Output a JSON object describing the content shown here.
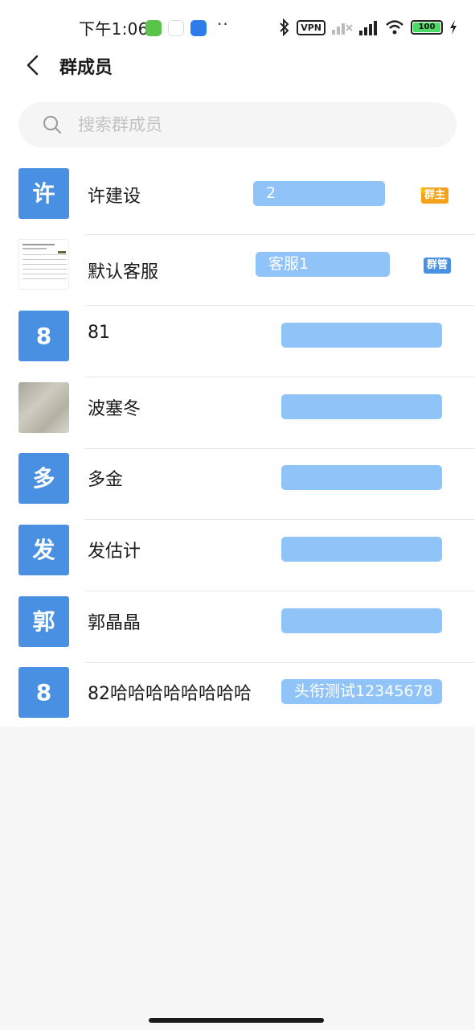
{
  "status_bar": {
    "time": "下午1:06",
    "vpn_label": "VPN",
    "battery": "100",
    "dots": "··"
  },
  "header": {
    "title": "群成员"
  },
  "search": {
    "placeholder": "搜索群成员"
  },
  "members": [
    {
      "avatar_text": "许",
      "name": "许建设",
      "tag": "2",
      "badge": "群主",
      "badge_type": "owner"
    },
    {
      "avatar_text": "",
      "name": "默认客服",
      "tag": "客服1",
      "badge": "群管",
      "badge_type": "admin"
    },
    {
      "avatar_text": "8",
      "name": "81",
      "tag": "",
      "badge": "",
      "badge_type": ""
    },
    {
      "avatar_text": "",
      "name": "波塞冬",
      "tag": "",
      "badge": "",
      "badge_type": ""
    },
    {
      "avatar_text": "多",
      "name": "多金",
      "tag": "",
      "badge": "",
      "badge_type": ""
    },
    {
      "avatar_text": "发",
      "name": "发估计",
      "tag": "",
      "badge": "",
      "badge_type": ""
    },
    {
      "avatar_text": "郭",
      "name": "郭晶晶",
      "tag": "",
      "badge": "",
      "badge_type": ""
    },
    {
      "avatar_text": "8",
      "name": "82哈哈哈哈哈哈哈哈",
      "tag": "头衔测试12345678",
      "badge": "",
      "badge_type": ""
    }
  ],
  "colors": {
    "avatar_blue": "#4a90e2",
    "tag_blue": "#90c4f8",
    "owner_badge": "#f4a21b",
    "admin_badge": "#4a90e2"
  }
}
